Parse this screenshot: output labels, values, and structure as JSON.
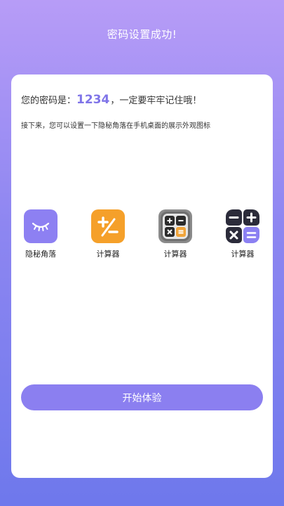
{
  "header": {
    "title": "密码设置成功!"
  },
  "message": {
    "prefix": "您的密码是：",
    "password": "1234",
    "suffix": "，一定要牢牢记住哦！"
  },
  "hint": "接下来，您可以设置一下隐秘角落在手机桌面的展示外观图标",
  "icons": [
    {
      "label": "隐秘角落",
      "icon": "closed-eye-icon",
      "color": "#8d80f2"
    },
    {
      "label": "计算器",
      "icon": "plus-minus-calculator-icon",
      "color": "#f5a02a"
    },
    {
      "label": "计算器",
      "icon": "gray-calculator-icon",
      "color": "#7a7a7a"
    },
    {
      "label": "计算器",
      "icon": "dark-purple-calculator-icon",
      "color": "#2b2b3a"
    }
  ],
  "start_button": {
    "label": "开始体验"
  },
  "colors": {
    "accent": "#8b7ff0",
    "password": "#7f74e8"
  }
}
